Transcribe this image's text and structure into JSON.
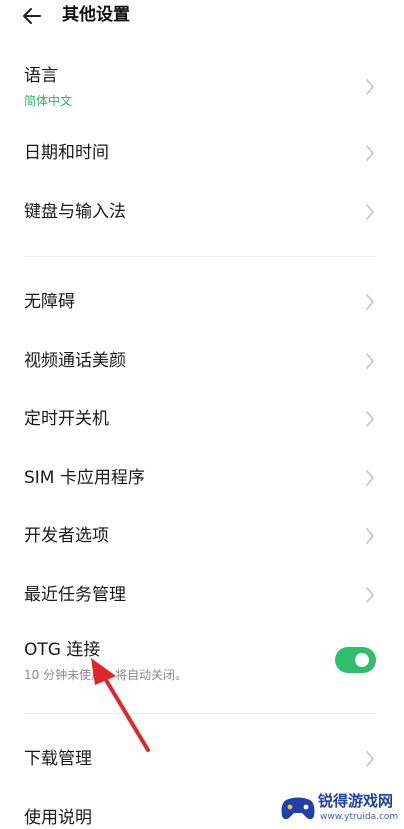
{
  "header": {
    "title": "其他设置"
  },
  "items": [
    {
      "label": "语言",
      "sub": "简体中文"
    },
    {
      "label": "日期和时间"
    },
    {
      "label": "键盘与输入法"
    },
    {
      "label": "无障碍"
    },
    {
      "label": "视频通话美颜"
    },
    {
      "label": "定时开关机"
    },
    {
      "label": "SIM 卡应用程序"
    },
    {
      "label": "开发者选项"
    },
    {
      "label": "最近任务管理"
    },
    {
      "label": "OTG 连接",
      "sub": "10 分钟未使用，将自动关闭。",
      "toggle_on": true
    },
    {
      "label": "下载管理"
    },
    {
      "label": "使用说明"
    }
  ],
  "watermark": {
    "name": "锐得游戏网",
    "url": "www.ytruida.com"
  },
  "colors": {
    "accent": "#2fbe6b",
    "sub_green": "#2fb36a",
    "annotation_arrow": "#e0262b"
  },
  "icons": {
    "back": "arrow-left-icon",
    "chevron": "chevron-right-icon"
  }
}
